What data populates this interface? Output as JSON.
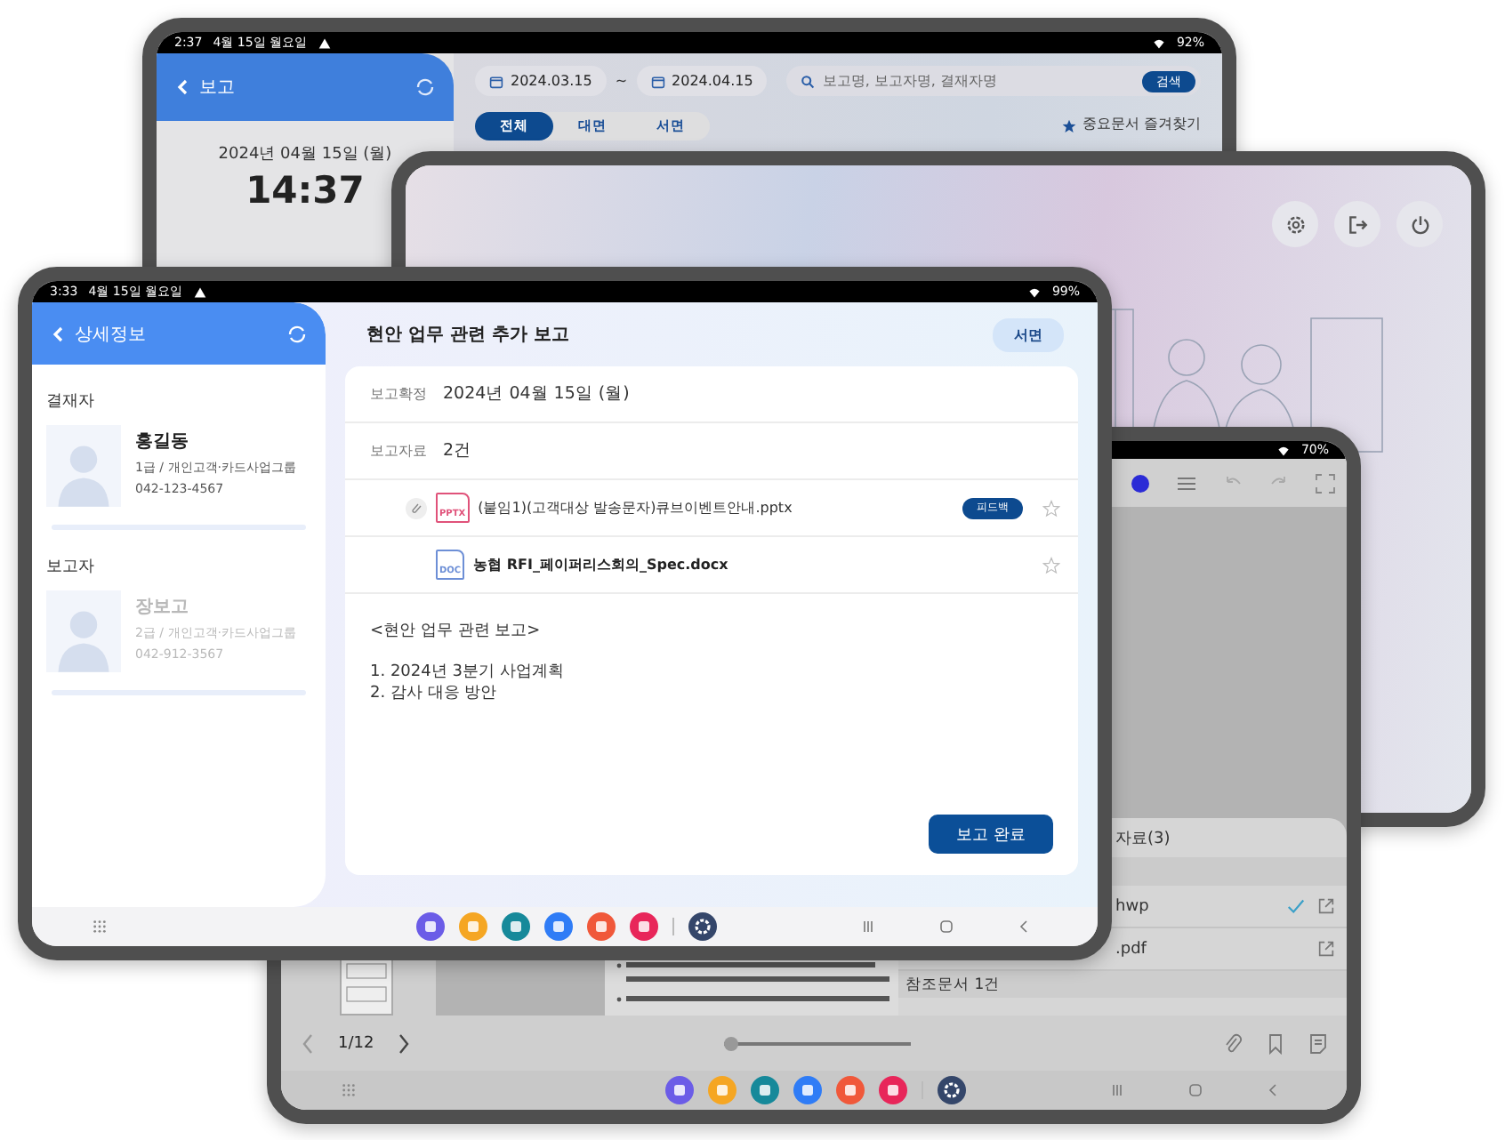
{
  "report_list_tablet": {
    "status_bar": {
      "time": "2:37",
      "date": "4월 15일 월요일",
      "battery": "92%"
    },
    "header": {
      "title": "보고"
    },
    "clock": {
      "date": "2024년 04월 15일 (월)",
      "time": "14:37"
    },
    "filter": {
      "start_date": "2024.03.15",
      "separator": "~",
      "end_date": "2024.04.15",
      "search": {
        "placeholder": "보고명, 보고자명, 결재자명"
      },
      "search_button": "검색"
    },
    "tabs": [
      {
        "label": "전체",
        "selected": true
      },
      {
        "label": "대면",
        "selected": false
      },
      {
        "label": "서면",
        "selected": false
      }
    ],
    "favorites_link": "중요문서 즐겨찾기"
  },
  "viewer_tablet": {
    "status_bar": {
      "battery": "70%"
    },
    "attachments": {
      "title": "자료(3)",
      "files": [
        {
          "name": "hwp",
          "checked": true
        },
        {
          "name": ".pdf",
          "checked": false
        }
      ],
      "reference_heading": "참조문서 1건"
    },
    "pager": {
      "page": "1/12",
      "level": 0
    }
  },
  "detail_tablet": {
    "status_bar": {
      "time": "3:33",
      "date": "4월 15일 월요일",
      "battery": "99%"
    },
    "sidebar": {
      "title": "상세정보",
      "people": [
        {
          "role": "결재자",
          "name": "홍길동",
          "position": "1급 / 개인고객·카드사업그룹",
          "phone": "042-123-4567",
          "muted": false
        },
        {
          "role": "보고자",
          "name": "장보고",
          "position": "2급 / 개인고객·카드사업그룹",
          "phone": "042-912-3567",
          "muted": true
        }
      ]
    },
    "report": {
      "title": "현안 업무 관련 추가 보고",
      "type_badge": "서면",
      "fields": [
        {
          "label": "보고확정",
          "value": "2024년 04월 15일 (월)"
        },
        {
          "label": "보고자료",
          "value": "2건"
        }
      ],
      "files": [
        {
          "kind": "pptx",
          "icon_label": "PPTX",
          "name": "(붙임1)(고객대상 발송문자)큐브이벤트안내.pptx",
          "badge": "피드백",
          "emphasized": false
        },
        {
          "kind": "doc",
          "icon_label": "DOC",
          "name": "농협 RFI_페이퍼리스회의_Spec.docx",
          "emphasized": true
        }
      ],
      "body": {
        "heading": "<현안 업무 관련 보고>",
        "items": [
          "1. 2024년 3분기 사업계획",
          "2. 감사 대응 방안"
        ]
      },
      "submit_button": "보고 완료"
    }
  }
}
